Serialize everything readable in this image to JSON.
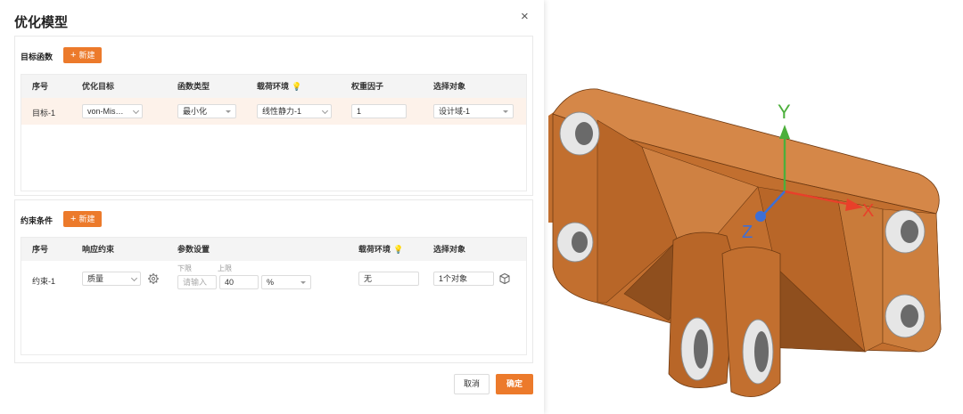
{
  "dialog": {
    "title": "优化模型",
    "close_label": "×"
  },
  "objective": {
    "section_label": "目标函数",
    "new_button": "新建",
    "headers": [
      "序号",
      "优化目标",
      "函数类型",
      "载荷环境",
      "权重因子",
      "选择对象"
    ],
    "rows": [
      {
        "index": "目标-1",
        "target": "von-Mis…",
        "func_type": "最小化",
        "load_env": "线性静力-1",
        "weight": "1",
        "select": "设计域-1"
      }
    ]
  },
  "constraint": {
    "section_label": "约束条件",
    "new_button": "新建",
    "headers": [
      "序号",
      "响应约束",
      "参数设置",
      "载荷环境",
      "选择对象"
    ],
    "lower_label": "下限",
    "upper_label": "上限",
    "rows": [
      {
        "index": "约束-1",
        "response": "质量",
        "lower_placeholder": "请输入",
        "upper": "40",
        "unit": "%",
        "load_env": "无",
        "select": "1个对象"
      }
    ]
  },
  "footer": {
    "cancel": "取消",
    "ok": "确定"
  },
  "viewport": {
    "axis_y": "Y",
    "axis_x": "X",
    "axis_z": "Z"
  },
  "colors": {
    "accent": "#ec7a2b",
    "row_highlight": "#fdf2ea",
    "part_top": "#d58748",
    "part_side": "#c26f2f",
    "part_dark": "#8f4f1e",
    "axis_y": "#4caf3b",
    "axis_x": "#e8402a",
    "axis_z": "#3d6fd6"
  }
}
